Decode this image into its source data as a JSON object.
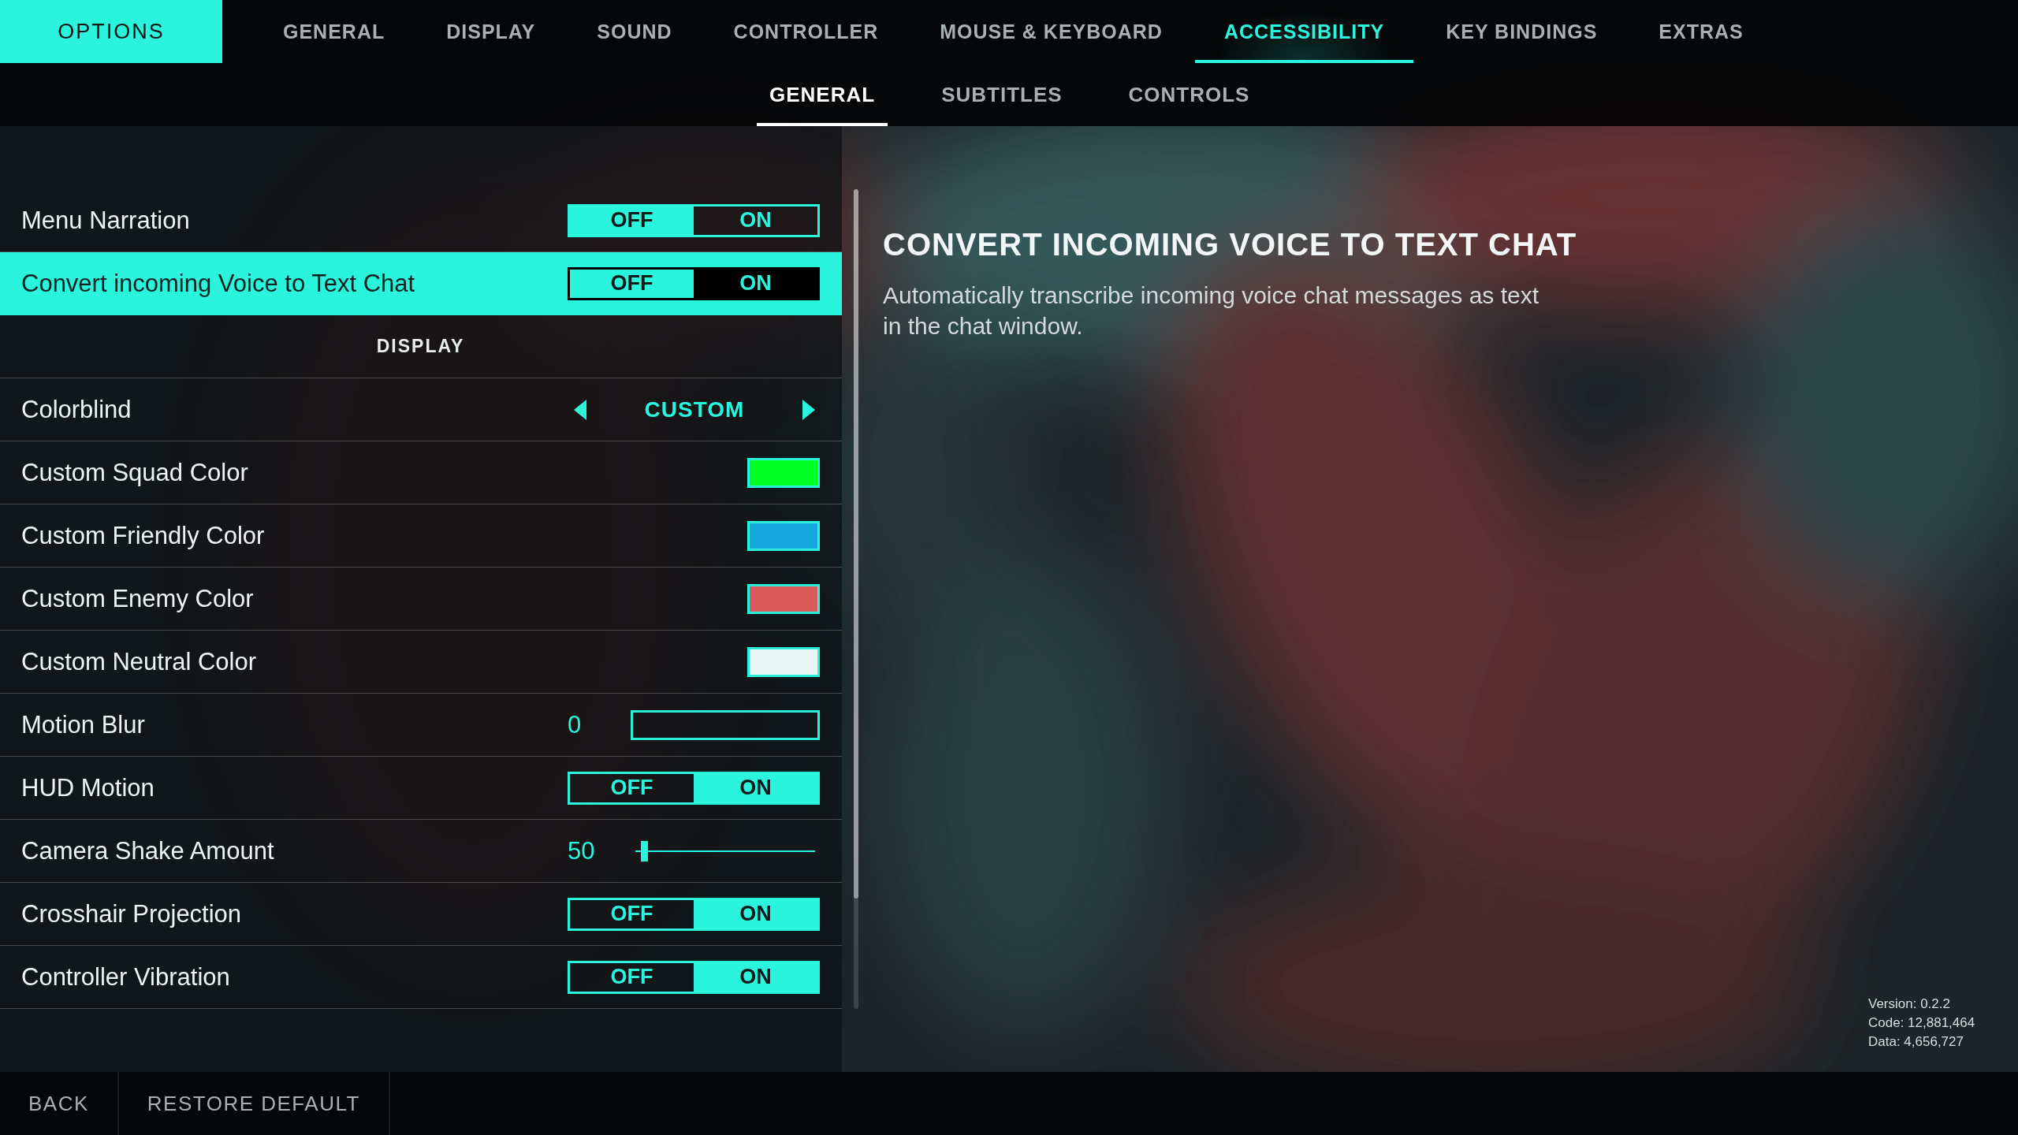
{
  "top_nav": {
    "title": "OPTIONS",
    "items": [
      {
        "label": "GENERAL",
        "selected": false
      },
      {
        "label": "DISPLAY",
        "selected": false
      },
      {
        "label": "SOUND",
        "selected": false
      },
      {
        "label": "CONTROLLER",
        "selected": false
      },
      {
        "label": "MOUSE & KEYBOARD",
        "selected": false
      },
      {
        "label": "ACCESSIBILITY",
        "selected": true
      },
      {
        "label": "KEY BINDINGS",
        "selected": false
      },
      {
        "label": "EXTRAS",
        "selected": false
      }
    ]
  },
  "sub_tabs": [
    {
      "label": "GENERAL",
      "selected": true
    },
    {
      "label": "SUBTITLES",
      "selected": false
    },
    {
      "label": "CONTROLS",
      "selected": false
    }
  ],
  "settings": [
    {
      "kind": "toggle",
      "label": "Menu Narration",
      "off_label": "OFF",
      "on_label": "ON",
      "on": false,
      "focused": false
    },
    {
      "kind": "toggle",
      "label": "Convert incoming Voice to Text Chat",
      "off_label": "OFF",
      "on_label": "ON",
      "on": true,
      "focused": true
    },
    {
      "kind": "header",
      "label": "DISPLAY",
      "focused": false
    },
    {
      "kind": "selector",
      "label": "Colorblind",
      "value": "CUSTOM",
      "focused": false
    },
    {
      "kind": "color",
      "label": "Custom Squad Color",
      "color": "#00ff22",
      "focused": false
    },
    {
      "kind": "color",
      "label": "Custom Friendly Color",
      "color": "#16a8dc",
      "focused": false
    },
    {
      "kind": "color",
      "label": "Custom Enemy Color",
      "color": "#d85a5a",
      "focused": false
    },
    {
      "kind": "color",
      "label": "Custom Neutral Color",
      "color": "#e8f6f6",
      "focused": false
    },
    {
      "kind": "bar",
      "label": "Motion Blur",
      "reading": "0",
      "level": 0,
      "focused": false
    },
    {
      "kind": "toggle",
      "label": "HUD Motion",
      "off_label": "OFF",
      "on_label": "ON",
      "on": true,
      "focused": false
    },
    {
      "kind": "line",
      "label": "Camera Shake Amount",
      "reading": "50",
      "level": 0.03,
      "focused": false
    },
    {
      "kind": "toggle",
      "label": "Crosshair Projection",
      "off_label": "OFF",
      "on_label": "ON",
      "on": true,
      "focused": false
    },
    {
      "kind": "toggle",
      "label": "Controller Vibration",
      "off_label": "OFF",
      "on_label": "ON",
      "on": true,
      "focused": false
    }
  ],
  "detail": {
    "title": "CONVERT INCOMING VOICE TO TEXT CHAT",
    "description": "Automatically transcribe incoming voice chat messages as text in the chat window."
  },
  "build_info": [
    "Version: 0.2.2",
    "Code: 12,881,464",
    "Data: 4,656,727"
  ],
  "footer": [
    "BACK",
    "RESTORE DEFAULT"
  ]
}
